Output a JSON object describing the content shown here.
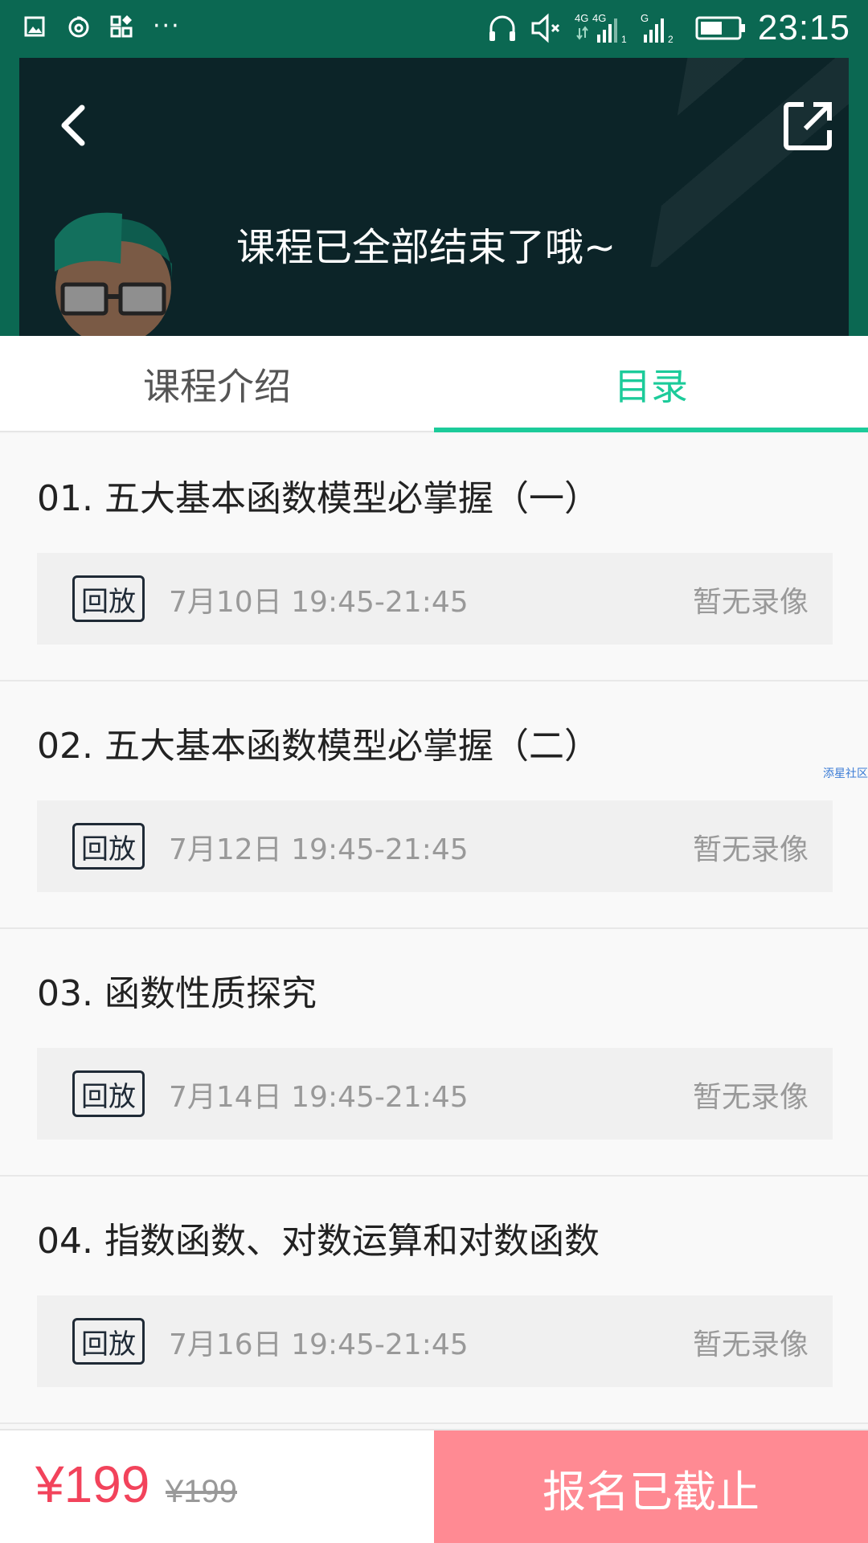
{
  "status_bar": {
    "time": "23:15",
    "network_1": "4G",
    "network_2": "4G",
    "sim1": "1",
    "sim2": "2",
    "g_label": "G",
    "more": "···"
  },
  "header": {
    "banner_text": "课程已全部结束了哦~"
  },
  "tabs": [
    {
      "label": "课程介绍",
      "active": false
    },
    {
      "label": "目录",
      "active": true
    }
  ],
  "lessons": [
    {
      "title": "01. 五大基本函数模型必掌握（一）",
      "tag": "回放",
      "time": "7月10日 19:45-21:45",
      "status": "暂无录像"
    },
    {
      "title": "02. 五大基本函数模型必掌握（二）",
      "tag": "回放",
      "time": "7月12日 19:45-21:45",
      "status": "暂无录像"
    },
    {
      "title": "03. 函数性质探究",
      "tag": "回放",
      "time": "7月14日 19:45-21:45",
      "status": "暂无录像"
    },
    {
      "title": "04. 指数函数、对数运算和对数函数",
      "tag": "回放",
      "time": "7月16日 19:45-21:45",
      "status": "暂无录像"
    }
  ],
  "watermark": "添星社区",
  "bottom": {
    "price": "¥199",
    "original_price": "¥199",
    "signup_label": "报名已截止"
  },
  "colors": {
    "accent": "#1ccb9a",
    "status_bar": "#0b6852",
    "header_bg": "#0c2428",
    "price": "#f2435b",
    "signup_bg": "#ff8a93"
  }
}
